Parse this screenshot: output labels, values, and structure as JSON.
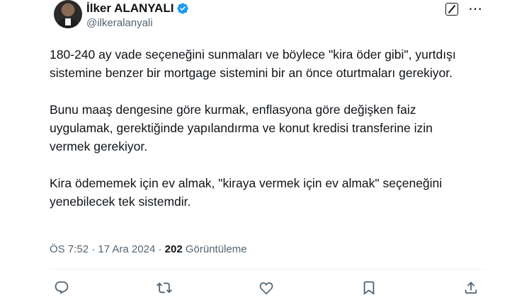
{
  "author": {
    "name": "İlker ALANYALI",
    "handle": "@ilkeralanyali",
    "verified": true
  },
  "tweet": {
    "paragraphs": [
      "180-240 ay vade seçeneğini sunmaları ve böylece \"kira öder gibi\", yurtdışı sistemine benzer bir mortgage sistemini bir an önce oturtmaları gerekiyor.",
      "Bunu maaş dengesine göre kurmak, enflasyona göre değişken faiz uygulamak, gerektiğinde yapılandırma ve konut kredisi transferine izin vermek gerekiyor.",
      "Kira ödememek için ev almak, \"kiraya vermek için ev almak\" seçeneğini yenebilecek tek sistemdir."
    ]
  },
  "meta": {
    "time": "ÖS 7:52",
    "sep1": "·",
    "date": "17 Ara 2024",
    "sep2": "·",
    "views_count": "202",
    "views_label": "Görüntüleme"
  },
  "icons": {
    "verified": "verified-badge-icon",
    "edit": "grok-edit-icon",
    "more": "more-icon",
    "reply": "reply-icon",
    "retweet": "retweet-icon",
    "like": "like-icon",
    "bookmark": "bookmark-icon",
    "share": "share-icon"
  },
  "colors": {
    "text": "#0f1419",
    "secondary": "#536471",
    "verified": "#1d9bf0"
  }
}
